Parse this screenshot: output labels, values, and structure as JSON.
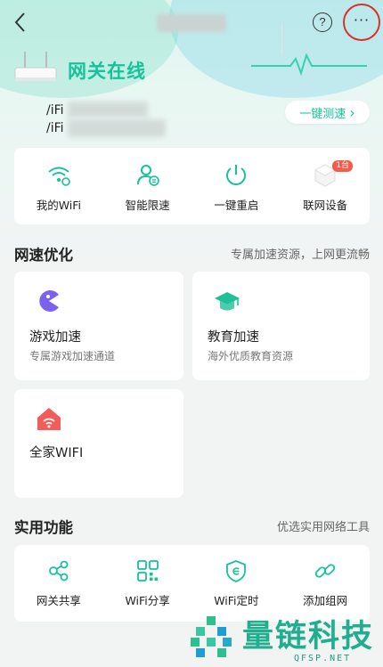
{
  "header": {
    "help_icon": "?",
    "more_icon": "···"
  },
  "gateway": {
    "status": "网关在线",
    "wifi_line1_prefix": "/iFi",
    "wifi_line2_prefix": "/iFi",
    "speed_test_label": "一键测速",
    "speed_test_arrow": "›"
  },
  "quick_actions": [
    {
      "label": "我的WiFi",
      "icon": "wifi-settings-icon"
    },
    {
      "label": "智能限速",
      "icon": "user-limit-icon"
    },
    {
      "label": "一键重启",
      "icon": "power-icon"
    },
    {
      "label": "联网设备",
      "icon": "devices-icon",
      "badge": "1台"
    }
  ],
  "speed_section": {
    "title": "网速优化",
    "subtitle": "专属加速资源，上网更流畅",
    "cards": [
      {
        "title": "游戏加速",
        "subtitle": "专属游戏加速通道",
        "icon": "game-icon",
        "color": "#7b61f0"
      },
      {
        "title": "教育加速",
        "subtitle": "海外优质教育资源",
        "icon": "graduation-cap-icon",
        "color": "#1fbf97"
      },
      {
        "title": "全家WIFI",
        "subtitle": "",
        "icon": "home-wifi-icon",
        "color": "#f25d5b"
      }
    ]
  },
  "util_section": {
    "title": "实用功能",
    "subtitle": "优选实用网络工具",
    "items": [
      {
        "label": "网关共享",
        "icon": "share-icon"
      },
      {
        "label": "WiFi分享",
        "icon": "qr-code-icon"
      },
      {
        "label": "WiFi定时",
        "icon": "timer-shield-icon"
      },
      {
        "label": "添加组网",
        "icon": "link-icon"
      }
    ]
  },
  "watermark": {
    "text": "量链科技",
    "url": "QFSP.NET"
  },
  "colors": {
    "accent": "#15c39a",
    "highlight_ring": "#d9302c"
  }
}
